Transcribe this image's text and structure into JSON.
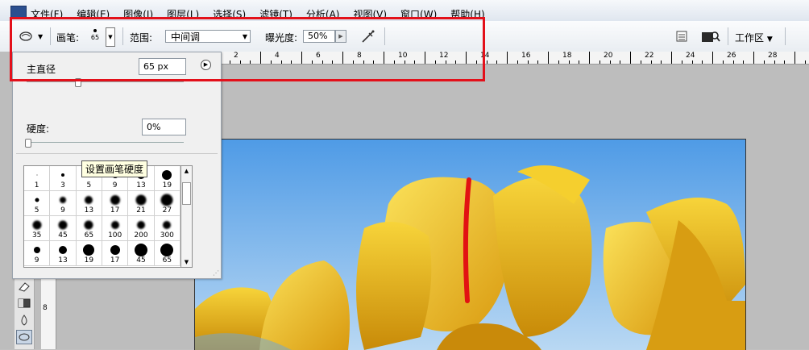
{
  "menubar": {
    "items": [
      "文件(F)",
      "编辑(E)",
      "图像(I)",
      "图层(L)",
      "选择(S)",
      "滤镜(T)",
      "分析(A)",
      "视图(V)",
      "窗口(W)",
      "帮助(H)"
    ]
  },
  "options": {
    "brush_label": "画笔:",
    "brush_size_preview": "65",
    "range_label": "范围:",
    "range_value": "中间调",
    "exposure_label": "曝光度:",
    "exposure_value": "50%",
    "workspace_label": "工作区"
  },
  "brush_panel": {
    "diameter_label": "主直径",
    "diameter_value": "65 px",
    "hardness_label": "硬度:",
    "hardness_value": "0%",
    "tooltip": "设置画笔硬度",
    "presets": [
      {
        "size": 1,
        "label": "1"
      },
      {
        "size": 3,
        "label": "3"
      },
      {
        "size": 5,
        "label": "5"
      },
      {
        "size": 9,
        "label": "9"
      },
      {
        "size": 13,
        "label": "13"
      },
      {
        "size": 19,
        "label": "19"
      },
      {
        "size": 5,
        "label": "5"
      },
      {
        "size": 9,
        "label": "9"
      },
      {
        "size": 13,
        "label": "13"
      },
      {
        "size": 17,
        "label": "17"
      },
      {
        "size": 21,
        "label": "21"
      },
      {
        "size": 27,
        "label": "27"
      },
      {
        "size": 35,
        "label": "35"
      },
      {
        "size": 45,
        "label": "45"
      },
      {
        "size": 65,
        "label": "65"
      },
      {
        "size": 100,
        "label": "100"
      },
      {
        "size": 200,
        "label": "200"
      },
      {
        "size": 300,
        "label": "300"
      },
      {
        "size": 9,
        "label": "9"
      },
      {
        "size": 13,
        "label": "13"
      },
      {
        "size": 19,
        "label": "19"
      },
      {
        "size": 17,
        "label": "17"
      },
      {
        "size": 45,
        "label": "45"
      },
      {
        "size": 65,
        "label": "65"
      }
    ]
  },
  "ruler": {
    "h_labels": [
      "2",
      "4",
      "6",
      "8",
      "10",
      "12",
      "14",
      "16",
      "18",
      "20",
      "22",
      "24",
      "26",
      "28"
    ],
    "v_labels": [
      "8"
    ]
  },
  "colors": {
    "highlight": "#e3101a"
  }
}
